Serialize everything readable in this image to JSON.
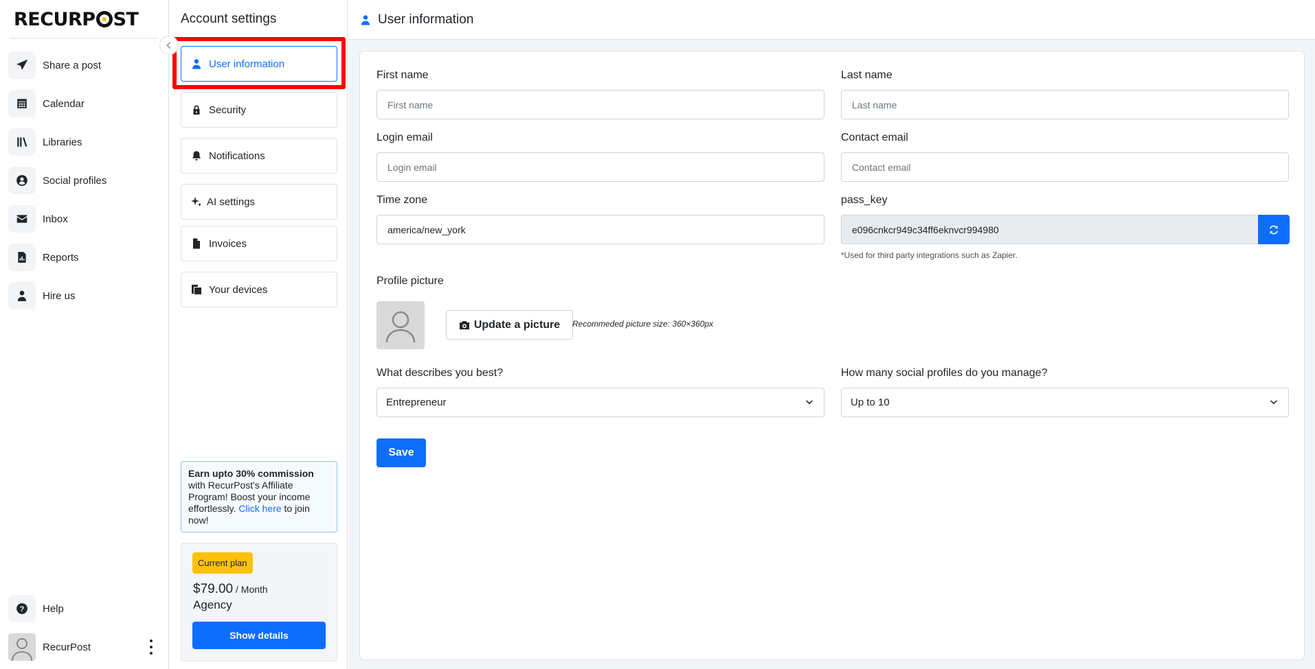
{
  "brand": {
    "logo_text_before": "RECURP",
    "logo_text_after": "ST"
  },
  "leftnav": {
    "items": [
      {
        "label": "Share a post",
        "icon": "send-icon"
      },
      {
        "label": "Calendar",
        "icon": "calendar-icon"
      },
      {
        "label": "Libraries",
        "icon": "library-icon"
      },
      {
        "label": "Social profiles",
        "icon": "user-circle-icon"
      },
      {
        "label": "Inbox",
        "icon": "envelope-icon"
      },
      {
        "label": "Reports",
        "icon": "report-icon"
      },
      {
        "label": "Hire us",
        "icon": "person-icon"
      }
    ],
    "help_label": "Help",
    "user_name": "RecurPost"
  },
  "settings": {
    "title": "Account settings",
    "items": [
      {
        "label": "User information",
        "icon": "user-icon",
        "active": true
      },
      {
        "label": "Security",
        "icon": "lock-icon"
      },
      {
        "label": "Notifications",
        "icon": "bell-icon"
      },
      {
        "label": "AI settings",
        "icon": "sparkle-icon"
      },
      {
        "label": "Invoices",
        "icon": "file-icon"
      },
      {
        "label": "Your devices",
        "icon": "devices-icon"
      }
    ],
    "affiliate": {
      "bold": "Earn upto 30% commission",
      "text1": " with RecurPost's Affiliate Program! Boost your income effortlessly. ",
      "link": "Click here",
      "text2": " to join now!"
    },
    "plan": {
      "badge": "Current plan",
      "price": "$79.00",
      "period": " / Month",
      "name": "Agency",
      "button": "Show details"
    }
  },
  "main": {
    "header_title": "User information",
    "form": {
      "first_name_label": "First name",
      "first_name_placeholder": "First name",
      "last_name_label": "Last name",
      "last_name_placeholder": "Last name",
      "login_email_label": "Login email",
      "login_email_placeholder": "Login email",
      "contact_email_label": "Contact email",
      "contact_email_placeholder": "Contact email",
      "timezone_label": "Time zone",
      "timezone_value": "america/new_york",
      "pass_key_label": "pass_key",
      "pass_key_value": "e096cnkcr949c34ff6eknvcr994980",
      "pass_key_hint": "*Used for third party integrations such as Zapier.",
      "profile_picture_label": "Profile picture",
      "update_picture_button": "Update a picture",
      "picture_size_note": "Recommeded picture size: 360×360px",
      "describes_label": "What describes you best?",
      "describes_value": "Entrepreneur",
      "profiles_label": "How many social profiles do you manage?",
      "profiles_value": "Up to 10",
      "save_button": "Save"
    }
  },
  "colors": {
    "primary": "#0d6efd",
    "badge": "#ffc107",
    "highlight": "#ff0000"
  }
}
